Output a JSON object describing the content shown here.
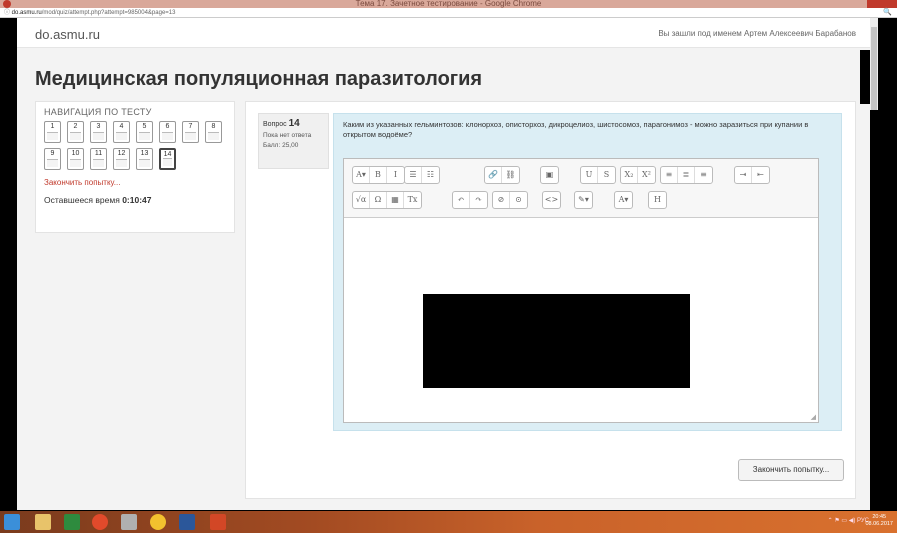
{
  "window": {
    "title": "Тема 17. Зачетное тестирование - Google Chrome"
  },
  "address": {
    "host": "do.asmu.ru",
    "path": "/mod/quiz/attempt.php?attempt=985004&page=13"
  },
  "site": {
    "brand": "do.asmu.ru",
    "login_text": "Вы зашли под именем Артем Алексеевич Барабанов"
  },
  "page": {
    "title": "Медицинская популяционная паразитология"
  },
  "nav": {
    "title": "НАВИГАЦИЯ ПО ТЕСТУ",
    "questions": [
      "1",
      "2",
      "3",
      "4",
      "5",
      "6",
      "7",
      "8",
      "9",
      "10",
      "11",
      "12",
      "13",
      "14"
    ],
    "current": "14",
    "finish_link": "Закончить попытку...",
    "timer_label": "Оставшееся время",
    "timer_value": "0:10:47"
  },
  "question": {
    "label": "Вопрос",
    "number": "14",
    "status": "Пока нет ответа",
    "mark": "Балл: 25,00",
    "text": "Каким из указанных гельминтозов: клонорхоз, описторхоз, дикроцелиоз, шистосомоз, парагонимоз - можно заразиться при купании в открытом водоёме?"
  },
  "editor": {
    "row1": [
      "A▾",
      "B",
      "I",
      "☰",
      "☷",
      "🔗",
      "⛓",
      "▣",
      "U",
      "S",
      "X₂",
      "X²",
      "≡",
      "≣",
      "≡",
      "⇥",
      "⇤"
    ],
    "row2": [
      "√α",
      "Ω",
      "▦",
      "Tx",
      "↶",
      "↷",
      "⊘",
      "⊙",
      "<>",
      "✎▾",
      "A▾",
      "H"
    ]
  },
  "actions": {
    "submit_label": "Закончить попытку..."
  },
  "taskbar": {
    "lang": "РУС",
    "time": "20:45",
    "date": "08.06.2017"
  }
}
